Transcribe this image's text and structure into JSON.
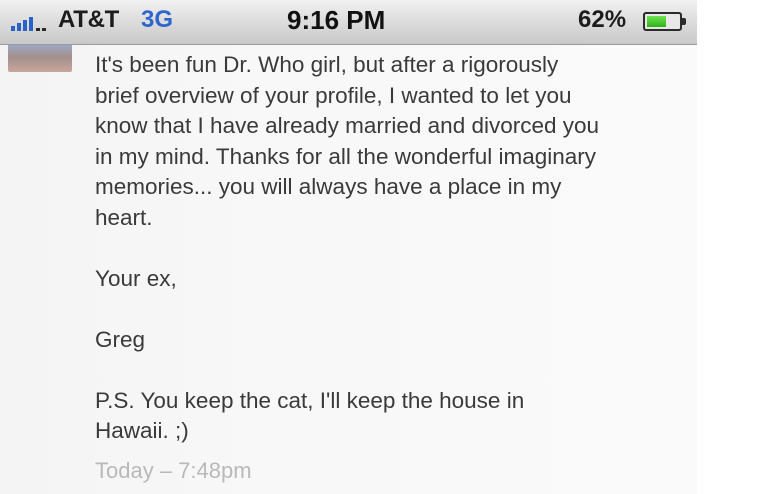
{
  "status_bar": {
    "carrier": "AT&T",
    "network": "3G",
    "time": "9:16 PM",
    "battery_percent": "62%",
    "battery_level": 0.62,
    "signal_bars": 4,
    "colors": {
      "network": "#2f66cc",
      "signal": "#2a63c7",
      "battery_fill": "#2fb21a"
    }
  },
  "message": {
    "body_lines": [
      "It's been fun Dr. Who girl, but after a rigorously",
      "brief overview of your profile, I wanted to let you",
      "know that I have already married and divorced you",
      "in my mind. Thanks for all the wonderful imaginary",
      "memories... you will always have a place in my",
      "heart."
    ],
    "signoff": "Your ex,",
    "signature": "Greg",
    "postscript_lines": [
      "P.S. You keep the cat, I'll keep the house in",
      "Hawaii. ;)"
    ],
    "timestamp": "Today – 7:48pm"
  }
}
